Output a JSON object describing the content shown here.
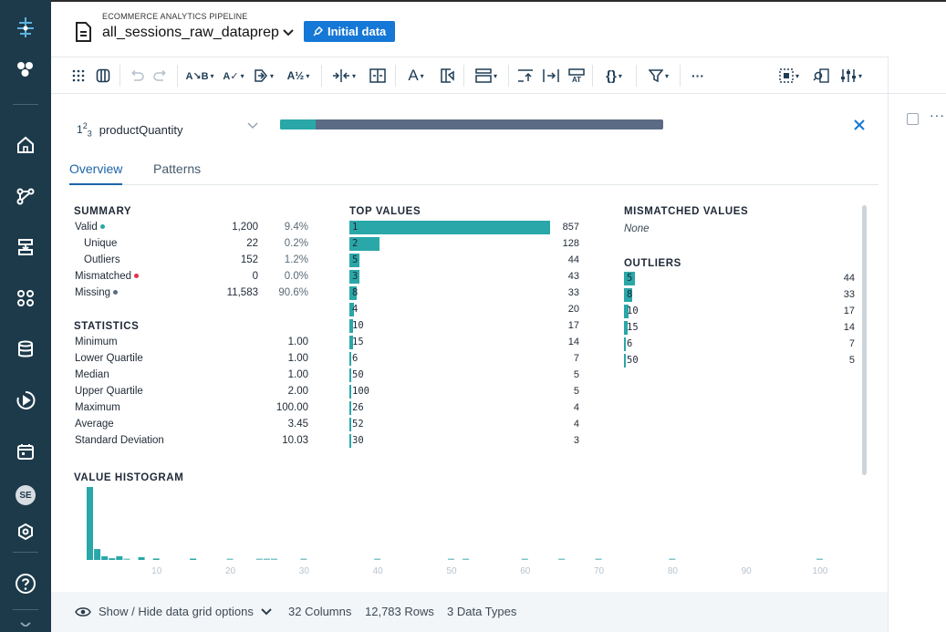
{
  "header": {
    "pipeline_name": "ECOMMERCE ANALYTICS PIPELINE",
    "recipe_name": "all_sessions_raw_dataprep",
    "initial_data_label": "Initial data"
  },
  "rail": {
    "avatar_initials": "SE"
  },
  "toolbar": {
    "icons": [
      "grid-dots-icon",
      "columns-icon",
      "undo-icon",
      "redo-icon",
      "replace-text-icon",
      "spellcheck-icon",
      "merge-icon",
      "sort-az-icon",
      "split-icon",
      "fit-column-icon",
      "font-icon",
      "column-format-icon",
      "table-format-icon",
      "move-up-icon",
      "move-in-icon",
      "text-transform-icon",
      "braces-icon",
      "filter-icon",
      "more-icon",
      "select-box-icon",
      "search-rows-icon",
      "settings-sliders-icon"
    ]
  },
  "column": {
    "type_label": "1",
    "type_sup": "2",
    "type_sub": "3",
    "name": "productQuantity",
    "quality_fraction": 0.094
  },
  "tabs": [
    {
      "label": "Overview",
      "active": true
    },
    {
      "label": "Patterns",
      "active": false
    }
  ],
  "summary": {
    "title": "SUMMARY",
    "rows": [
      {
        "label": "Valid",
        "count": "1,200",
        "pct": "9.4%",
        "dot": "#2aa7a8"
      },
      {
        "label": "Unique",
        "count": "22",
        "pct": "0.2%"
      },
      {
        "label": "Outliers",
        "count": "152",
        "pct": "1.2%"
      },
      {
        "label": "Mismatched",
        "count": "0",
        "pct": "0.0%",
        "dot": "#e0334b"
      },
      {
        "label": "Missing",
        "count": "11,583",
        "pct": "90.6%",
        "dot": "#5b6b85"
      }
    ]
  },
  "statistics": {
    "title": "STATISTICS",
    "rows": [
      {
        "label": "Minimum",
        "value": "1.00"
      },
      {
        "label": "Lower Quartile",
        "value": "1.00"
      },
      {
        "label": "Median",
        "value": "1.00"
      },
      {
        "label": "Upper Quartile",
        "value": "2.00"
      },
      {
        "label": "Maximum",
        "value": "100.00"
      },
      {
        "label": "Average",
        "value": "3.45"
      },
      {
        "label": "Standard Deviation",
        "value": "10.03"
      }
    ]
  },
  "top_values": {
    "title": "TOP VALUES",
    "max": 857,
    "rows": [
      {
        "value": "1",
        "count": 857
      },
      {
        "value": "2",
        "count": 128
      },
      {
        "value": "5",
        "count": 44
      },
      {
        "value": "3",
        "count": 43
      },
      {
        "value": "8",
        "count": 33
      },
      {
        "value": "4",
        "count": 20
      },
      {
        "value": "10",
        "count": 17
      },
      {
        "value": "15",
        "count": 14
      },
      {
        "value": "6",
        "count": 7
      },
      {
        "value": "50",
        "count": 5
      },
      {
        "value": "100",
        "count": 5
      },
      {
        "value": "26",
        "count": 4
      },
      {
        "value": "52",
        "count": 4
      },
      {
        "value": "30",
        "count": 3
      }
    ]
  },
  "mismatched": {
    "title": "MISMATCHED VALUES",
    "none_text": "None"
  },
  "outliers": {
    "title": "OUTLIERS",
    "max": 44,
    "rows": [
      {
        "value": "5",
        "count": 44
      },
      {
        "value": "8",
        "count": 33
      },
      {
        "value": "10",
        "count": 17
      },
      {
        "value": "15",
        "count": 14
      },
      {
        "value": "6",
        "count": 7
      },
      {
        "value": "50",
        "count": 5
      }
    ]
  },
  "histogram": {
    "title": "VALUE HISTOGRAM"
  },
  "chart_data": {
    "type": "bar",
    "title": "VALUE HISTOGRAM",
    "xlabel": "",
    "ylabel": "",
    "xlim": [
      1,
      100
    ],
    "x_ticks": [
      10,
      20,
      30,
      40,
      50,
      60,
      70,
      80,
      90,
      100
    ],
    "x": [
      1,
      2,
      3,
      4,
      5,
      6,
      8,
      10,
      15,
      20,
      24,
      25,
      26,
      30,
      40,
      50,
      52,
      60,
      65,
      70,
      80,
      100
    ],
    "values": [
      857,
      128,
      43,
      20,
      44,
      7,
      33,
      17,
      14,
      2,
      2,
      2,
      4,
      3,
      2,
      5,
      4,
      2,
      2,
      2,
      2,
      5
    ]
  },
  "footer": {
    "toggle_label": "Show / Hide data grid options",
    "columns": "32 Columns",
    "rows": "12,783 Rows",
    "types": "3 Data Types"
  },
  "colors": {
    "rail": "#1d3a4a",
    "accent": "#1577d6",
    "bar": "#2aa7a8",
    "missing": "#5b6b85",
    "mismatched": "#e0334b"
  }
}
